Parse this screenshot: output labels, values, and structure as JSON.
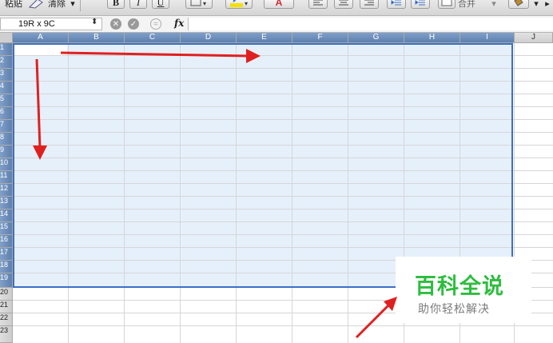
{
  "toolbar": {
    "paste_label": "粘贴",
    "clear_label": "清除",
    "bold_label": "B",
    "italic_label": "I",
    "underline_label": "U",
    "font_color_label": "A",
    "merge_label": "合并",
    "accent_font_color": "#d0262b",
    "accent_highlight": "#f2e100"
  },
  "formula_bar": {
    "name_box_value": "19R x 9C",
    "fx_label": "fx",
    "formula_value": ""
  },
  "columns": [
    "A",
    "B",
    "C",
    "D",
    "E",
    "F",
    "G",
    "H",
    "I",
    "J"
  ],
  "rows": [
    "1",
    "2",
    "3",
    "4",
    "5",
    "6",
    "7",
    "8",
    "9",
    "10",
    "11",
    "12",
    "13",
    "14",
    "15",
    "16",
    "17",
    "18",
    "19",
    "20",
    "21",
    "22",
    "23"
  ],
  "selection": {
    "rows_selected": 19,
    "cols_selected": 9,
    "fill_color": "#e6f0fb",
    "border_color": "#3a6fc4"
  },
  "annotation": {
    "arrow_color": "#e02020",
    "arrows": [
      "right",
      "down",
      "up-right"
    ]
  },
  "watermark": {
    "title": "百科全说",
    "subtitle": "助你轻松解决",
    "title_color": "#2ebd3f"
  }
}
